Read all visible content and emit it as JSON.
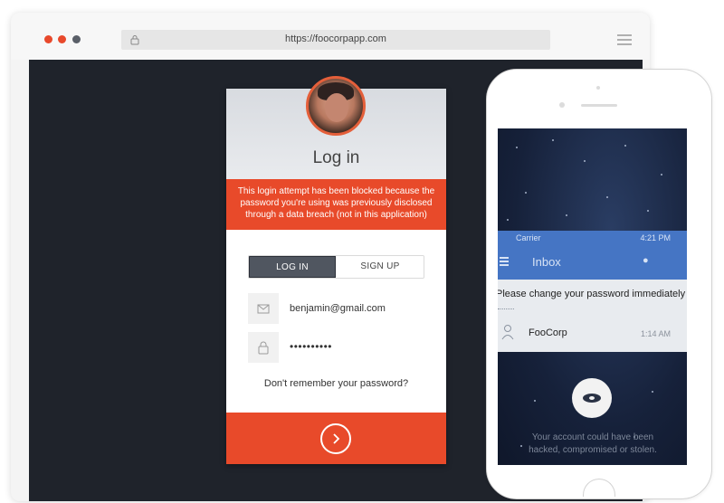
{
  "browser": {
    "url": "https://foocorpapp.com",
    "icons": [
      "close-dot",
      "minimize-dot",
      "maximize-dot",
      "lock-icon",
      "menu-icon"
    ]
  },
  "login": {
    "title": "Log in",
    "alert": "This login attempt has been blocked because the password you're using was previously disclosed through a data breach (not in this application)",
    "tabs": {
      "login": "LOG IN",
      "signup": "SIGN UP"
    },
    "email_value": "benjamin@gmail.com",
    "password_value": "••••••••••",
    "forgot": "Don't remember your password?",
    "colors": {
      "accent": "#e84a2a",
      "tab_active": "#505660"
    }
  },
  "phone": {
    "status": {
      "carrier": "Carrier",
      "time": "4:21 PM"
    },
    "app_title": "Inbox",
    "notification": {
      "title": "Please change your password immediately",
      "sender": "FooCorp",
      "time": "1:14 AM"
    },
    "message": "Your account could have been hacked, compromised or stolen.",
    "colors": {
      "app_bar": "#4575c4"
    }
  }
}
